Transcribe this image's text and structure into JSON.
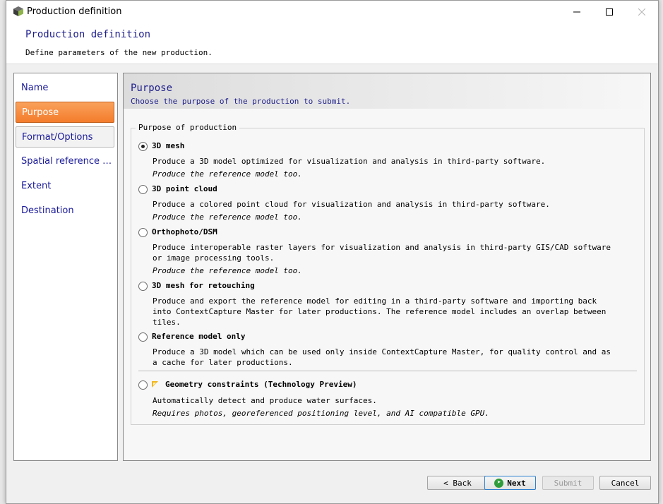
{
  "window": {
    "title": "Production definition",
    "controls": {
      "minimize": "minimize-icon",
      "maximize": "maximize-icon",
      "close": "close-icon"
    }
  },
  "header": {
    "title": "Production definition",
    "subtitle": "Define parameters of the new production."
  },
  "nav": {
    "items": [
      {
        "label": "Name"
      },
      {
        "label": "Purpose"
      },
      {
        "label": "Format/Options"
      },
      {
        "label": "Spatial reference system"
      },
      {
        "label": "Extent"
      },
      {
        "label": "Destination"
      }
    ],
    "active_index": 1
  },
  "content": {
    "title": "Purpose",
    "subtitle": "Choose the purpose of the production to submit.",
    "group_label": "Purpose of production",
    "options": [
      {
        "title": "3D mesh",
        "desc": [
          "Produce a 3D model optimized for visualization and analysis in third-party software."
        ],
        "note": "Produce the reference model too.",
        "checked": true
      },
      {
        "title": "3D point cloud",
        "desc": [
          "Produce a colored point cloud for visualization and analysis in third-party software."
        ],
        "note": "Produce the reference model too.",
        "checked": false
      },
      {
        "title": "Orthophoto/DSM",
        "desc": [
          "Produce interoperable raster layers for visualization and analysis in third-party GIS/CAD software",
          "or image processing tools."
        ],
        "note": "Produce the reference model too.",
        "checked": false
      },
      {
        "title": "3D mesh for retouching",
        "desc": [
          "Produce and export the reference model for editing in a third-party software and importing back",
          "into ContextCapture Master for later productions. The reference model includes an overlap between",
          "tiles."
        ],
        "note": "",
        "checked": false
      },
      {
        "title": "Reference model only",
        "desc": [
          "Produce a 3D model which can be used only inside ContextCapture Master, for quality control and as",
          "a cache for later productions."
        ],
        "note": "",
        "checked": false
      },
      {
        "title": "Geometry constraints (Technology Preview)",
        "desc": [
          "Automatically detect and produce water surfaces."
        ],
        "note": "Requires photos, georeferenced positioning level, and AI compatible GPU.",
        "checked": false
      }
    ]
  },
  "buttons": {
    "back": "< Back",
    "next": "Next",
    "submit": "Submit",
    "cancel": "Cancel"
  },
  "colors": {
    "accent_orange": "#f47c2c",
    "title_blue": "#1f1f8c",
    "next_green": "#2f9c3a"
  }
}
